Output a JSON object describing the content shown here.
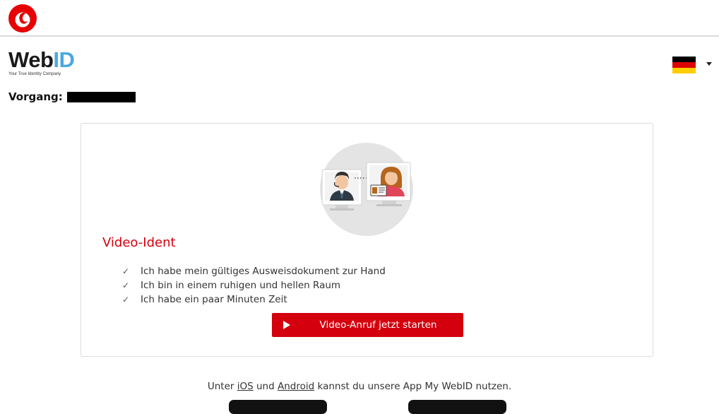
{
  "brand": {
    "tagline": "Your True Identity Company",
    "logo_web": "Web",
    "logo_id": "ID"
  },
  "language": {
    "selected": "Deutsch",
    "flag_colors": [
      "#000000",
      "#dd0000",
      "#ffce00"
    ]
  },
  "process": {
    "label": "Vorgang:"
  },
  "card": {
    "title": "Video-Ident",
    "checklist": [
      "Ich habe mein gültiges Ausweisdokument zur Hand",
      "Ich bin in einem ruhigen und hellen Raum",
      "Ich habe ein paar Minuten Zeit"
    ],
    "check_mark": "✓",
    "button_label": "Video-Anruf jetzt starten"
  },
  "footer": {
    "prefix": "Unter",
    "ios_link": "iOS",
    "and": "und",
    "android_link": "Android",
    "suffix": "kannst du unsere App My WebID nutzen."
  },
  "colors": {
    "accent_red": "#d4000d",
    "webid_blue": "#4aa8e0"
  }
}
